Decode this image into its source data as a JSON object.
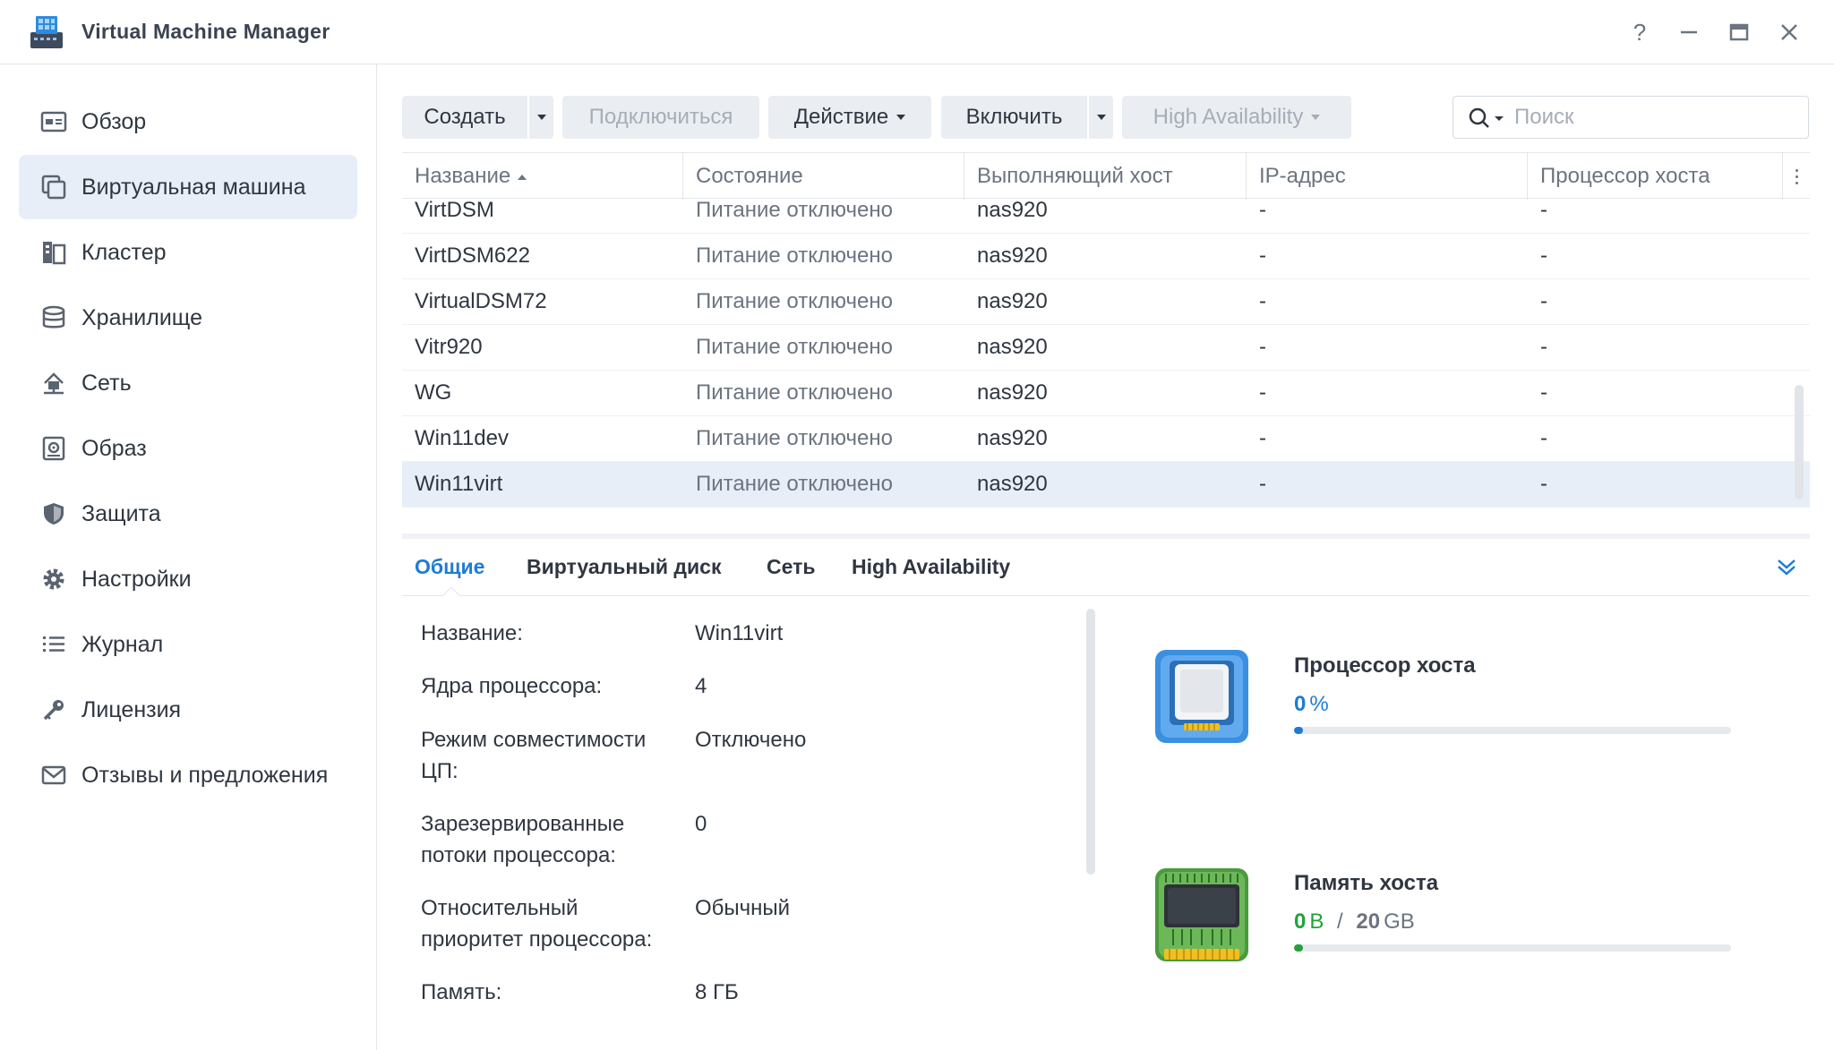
{
  "window": {
    "title": "Virtual Machine Manager",
    "help_label": "?",
    "minimize_label": "—",
    "close_label": "✕"
  },
  "sidebar": {
    "items": [
      {
        "label": "Обзор",
        "icon": "overview-icon"
      },
      {
        "label": "Виртуальная машина",
        "icon": "virtual-machine-icon",
        "active": true
      },
      {
        "label": "Кластер",
        "icon": "cluster-icon"
      },
      {
        "label": "Хранилище",
        "icon": "storage-icon"
      },
      {
        "label": "Сеть",
        "icon": "network-icon"
      },
      {
        "label": "Образ",
        "icon": "image-icon"
      },
      {
        "label": "Защита",
        "icon": "shield-icon"
      },
      {
        "label": "Настройки",
        "icon": "gear-icon"
      },
      {
        "label": "Журнал",
        "icon": "log-list-icon"
      },
      {
        "label": "Лицензия",
        "icon": "key-icon"
      },
      {
        "label": "Отзывы и предложения",
        "icon": "mail-icon"
      }
    ]
  },
  "toolbar": {
    "create_label": "Создать",
    "connect_label": "Подключиться",
    "action_label": "Действие",
    "power_on_label": "Включить",
    "ha_label": "High Availability",
    "search_placeholder": "Поиск"
  },
  "table": {
    "columns": [
      "Название",
      "Состояние",
      "Выполняющий хост",
      "IP-адрес",
      "Процессор хоста"
    ],
    "rows": [
      {
        "name": "VirtDSM",
        "status": "Питание отключено",
        "host": "nas920",
        "ip": "-",
        "cpu": "-"
      },
      {
        "name": "VirtDSM622",
        "status": "Питание отключено",
        "host": "nas920",
        "ip": "-",
        "cpu": "-"
      },
      {
        "name": "VirtualDSM72",
        "status": "Питание отключено",
        "host": "nas920",
        "ip": "-",
        "cpu": "-"
      },
      {
        "name": "Vitr920",
        "status": "Питание отключено",
        "host": "nas920",
        "ip": "-",
        "cpu": "-"
      },
      {
        "name": "WG",
        "status": "Питание отключено",
        "host": "nas920",
        "ip": "-",
        "cpu": "-"
      },
      {
        "name": "Win11dev",
        "status": "Питание отключено",
        "host": "nas920",
        "ip": "-",
        "cpu": "-"
      },
      {
        "name": "Win11virt",
        "status": "Питание отключено",
        "host": "nas920",
        "ip": "-",
        "cpu": "-",
        "selected": true
      }
    ]
  },
  "details": {
    "tabs": [
      "Общие",
      "Виртуальный диск",
      "Сеть",
      "High Availability"
    ],
    "properties": [
      {
        "label": "Название:",
        "value": "Win11virt"
      },
      {
        "label": "Ядра процессора:",
        "value": "4"
      },
      {
        "label": "Режим совместимости ЦП:",
        "value": "Отключено"
      },
      {
        "label": "Зарезервированные потоки процессора:",
        "value": "0"
      },
      {
        "label": "Относительный приоритет процессора:",
        "value": "Обычный"
      },
      {
        "label": "Память:",
        "value": "8 ГБ"
      }
    ],
    "cpu": {
      "title": "Процессор хоста",
      "value": "0",
      "unit": "%",
      "percent": 0,
      "color": "#1d7bd6"
    },
    "memory": {
      "title": "Память хоста",
      "used": "0",
      "used_unit": "B",
      "separator": "/",
      "total": "20",
      "total_unit": "GB",
      "percent": 0,
      "color": "#21a33a"
    }
  }
}
